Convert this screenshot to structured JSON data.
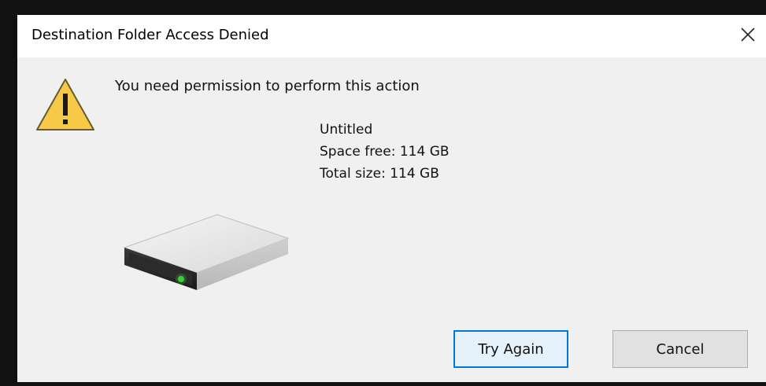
{
  "dialog": {
    "title": "Destination Folder Access Denied",
    "message": "You need permission to perform this action",
    "drive": {
      "name": "Untitled",
      "space_free": "Space free: 114 GB",
      "total_size": "Total size: 114 GB"
    },
    "buttons": {
      "try_again": "Try Again",
      "cancel": "Cancel"
    },
    "icons": {
      "close": "close-icon",
      "warning": "warning-icon",
      "drive": "hard-drive-icon"
    },
    "colors": {
      "accent": "#0078d7",
      "warning_fill": "#f7c948",
      "drive_led": "#3ad13a"
    }
  }
}
